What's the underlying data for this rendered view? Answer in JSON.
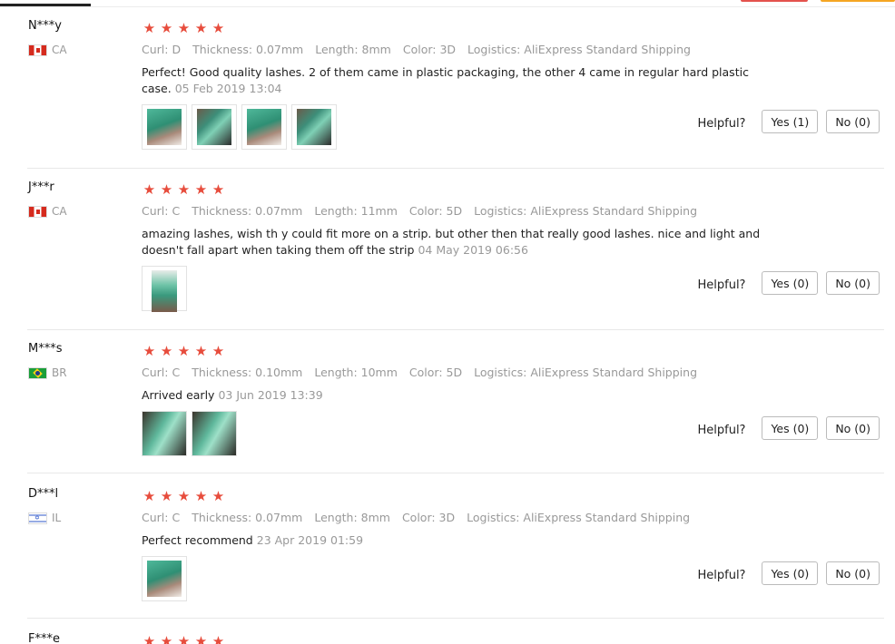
{
  "ui": {
    "helpful_label": "Helpful?"
  },
  "reviews": [
    {
      "user": "N***y",
      "country": "CA",
      "stars": 5,
      "attrs": [
        "Curl: D",
        "Thickness: 0.07mm",
        "Length: 8mm",
        "Color: 3D",
        "Logistics: AliExpress Standard Shipping"
      ],
      "text": "Perfect! Good quality lashes. 2 of them came in plastic packaging, the other 4 came in regular hard plastic case.",
      "date": "05 Feb 2019 13:04",
      "photo_count": 4,
      "yes": "Yes (1)",
      "no": "No (0)"
    },
    {
      "user": "J***r",
      "country": "CA",
      "stars": 5,
      "attrs": [
        "Curl: C",
        "Thickness: 0.07mm",
        "Length: 11mm",
        "Color: 5D",
        "Logistics: AliExpress Standard Shipping"
      ],
      "text": "amazing lashes, wish th y could fit more on a strip. but other then that really good lashes. nice and light and doesn't fall apart when taking them off the strip",
      "date": "04 May 2019 06:56",
      "photo_count": 1,
      "yes": "Yes (0)",
      "no": "No (0)"
    },
    {
      "user": "M***s",
      "country": "BR",
      "stars": 5,
      "attrs": [
        "Curl: C",
        "Thickness: 0.10mm",
        "Length: 10mm",
        "Color: 5D",
        "Logistics: AliExpress Standard Shipping"
      ],
      "text": "Arrived early",
      "date": "03 Jun 2019 13:39",
      "photo_count": 2,
      "yes": "Yes (0)",
      "no": "No (0)"
    },
    {
      "user": "D***l",
      "country": "IL",
      "stars": 5,
      "attrs": [
        "Curl: C",
        "Thickness: 0.07mm",
        "Length: 8mm",
        "Color: 3D",
        "Logistics: AliExpress Standard Shipping"
      ],
      "text": "Perfect recommend",
      "date": "23 Apr 2019 01:59",
      "photo_count": 1,
      "yes": "Yes (0)",
      "no": "No (0)"
    },
    {
      "user": "F***e",
      "stars": 5
    }
  ],
  "colors": {
    "star": "#e74c3c",
    "muted": "#999999",
    "divider": "#e8e8e8"
  }
}
